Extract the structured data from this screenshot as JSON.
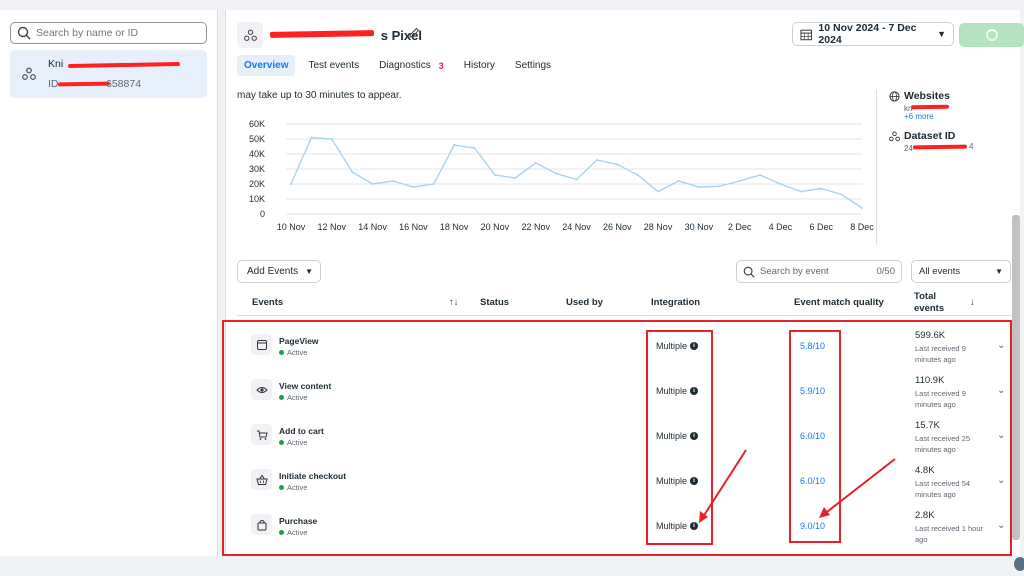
{
  "sidebar": {
    "search_placeholder": "Search by name or ID",
    "dataset": {
      "name": "Kni",
      "id_prefix": "ID ",
      "id_suffix": "658874"
    }
  },
  "header": {
    "pixel_title": "s Pixel",
    "date_range": "10 Nov 2024 - 7 Dec 2024"
  },
  "tabs": [
    {
      "label": "Overview",
      "active": true
    },
    {
      "label": "Test events"
    },
    {
      "label": "Diagnostics",
      "badge": "3"
    },
    {
      "label": "History"
    },
    {
      "label": "Settings"
    }
  ],
  "chart_note": "may take up to 30 minutes to appear.",
  "chart_data": {
    "type": "line",
    "x": [
      "10 Nov",
      "11 Nov",
      "12 Nov",
      "13 Nov",
      "14 Nov",
      "15 Nov",
      "16 Nov",
      "17 Nov",
      "18 Nov",
      "19 Nov",
      "20 Nov",
      "21 Nov",
      "22 Nov",
      "23 Nov",
      "24 Nov",
      "25 Nov",
      "26 Nov",
      "27 Nov",
      "28 Nov",
      "29 Nov",
      "30 Nov",
      "1 Dec",
      "2 Dec",
      "3 Dec",
      "4 Dec",
      "5 Dec",
      "6 Dec",
      "7 Dec",
      "8 Dec"
    ],
    "tick_labels": [
      "10 Nov",
      "12 Nov",
      "14 Nov",
      "16 Nov",
      "18 Nov",
      "20 Nov",
      "22 Nov",
      "24 Nov",
      "26 Nov",
      "28 Nov",
      "30 Nov",
      "2 Dec",
      "4 Dec",
      "6 Dec",
      "8 Dec"
    ],
    "y_ticks": [
      "0",
      "10K",
      "20K",
      "30K",
      "40K",
      "50K",
      "60K"
    ],
    "values": [
      20000,
      51000,
      50000,
      28000,
      20000,
      22000,
      18000,
      20000,
      46000,
      44000,
      26000,
      24000,
      34000,
      27000,
      23000,
      36000,
      33000,
      26000,
      15000,
      22000,
      18000,
      18500,
      22000,
      26000,
      20000,
      15000,
      17000,
      13000,
      4000
    ],
    "ylim": [
      0,
      60000
    ],
    "grid": true,
    "color": "#a8d4f0"
  },
  "side_info": {
    "websites_label": "Websites",
    "websites_value": "kn",
    "websites_more": "+6 more",
    "dataset_label": "Dataset ID",
    "dataset_value": "24",
    "dataset_value_end": "4"
  },
  "toolbar": {
    "add_events": "Add Events",
    "search_placeholder": "Search by event",
    "search_count": "0/50",
    "filter": "All events"
  },
  "columns": {
    "events": "Events",
    "sort": "↑↓",
    "status": "Status",
    "used_by": "Used by",
    "integration": "Integration",
    "emq": "Event match quality",
    "total_line1": "Total",
    "total_line2": "events",
    "total_sort": "↓"
  },
  "events": [
    {
      "name": "PageView",
      "status": "Active",
      "integration": "Multiple",
      "emq": "5.8/10",
      "total": "599.6K",
      "last": "Last received 9 minutes ago",
      "icon": "page-icon"
    },
    {
      "name": "View content",
      "status": "Active",
      "integration": "Multiple",
      "emq": "5.9/10",
      "total": "110.9K",
      "last": "Last received 9 minutes ago",
      "icon": "eye-icon"
    },
    {
      "name": "Add to cart",
      "status": "Active",
      "integration": "Multiple",
      "emq": "6.0/10",
      "total": "15.7K",
      "last": "Last received 25 minutes ago",
      "icon": "cart-icon"
    },
    {
      "name": "Initiate checkout",
      "status": "Active",
      "integration": "Multiple",
      "emq": "6.0/10",
      "total": "4.8K",
      "last": "Last received 54 minutes ago",
      "icon": "basket-icon"
    },
    {
      "name": "Purchase",
      "status": "Active",
      "integration": "Multiple",
      "emq": "9.0/10",
      "total": "2.8K",
      "last": "Last received 1 hour ago",
      "icon": "bag-icon"
    }
  ],
  "colors": {
    "accent": "#1877f2",
    "active_green": "#1e9e4a",
    "annotation_red": "#e8202a",
    "badge_red": "#e41e3f"
  }
}
